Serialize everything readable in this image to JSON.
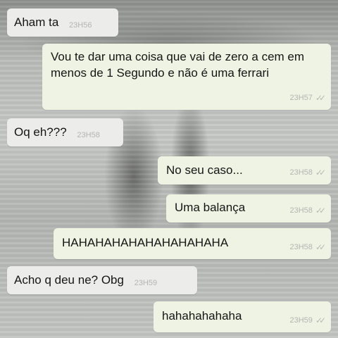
{
  "messages": [
    {
      "text": "Aham ta",
      "time": "23H56"
    },
    {
      "text": "Vou te dar uma coisa que vai de zero a cem em menos de 1 Segundo e não é uma ferrari",
      "time": "23H57",
      "ticks": "✓✓"
    },
    {
      "text": "Oq eh???",
      "time": "23H58"
    },
    {
      "text": "No seu caso...",
      "time": "23H58",
      "ticks": "✓✓"
    },
    {
      "text": "Uma balança",
      "time": "23H58",
      "ticks": "✓✓"
    },
    {
      "text": "HAHAHAHAHAHAHAHAHAHA",
      "time": "23H58",
      "ticks": "✓✓"
    },
    {
      "text": "Acho q deu ne? Obg",
      "time": "23H59"
    },
    {
      "text": "hahahahahaha",
      "time": "23H59",
      "ticks": "✓✓"
    }
  ]
}
